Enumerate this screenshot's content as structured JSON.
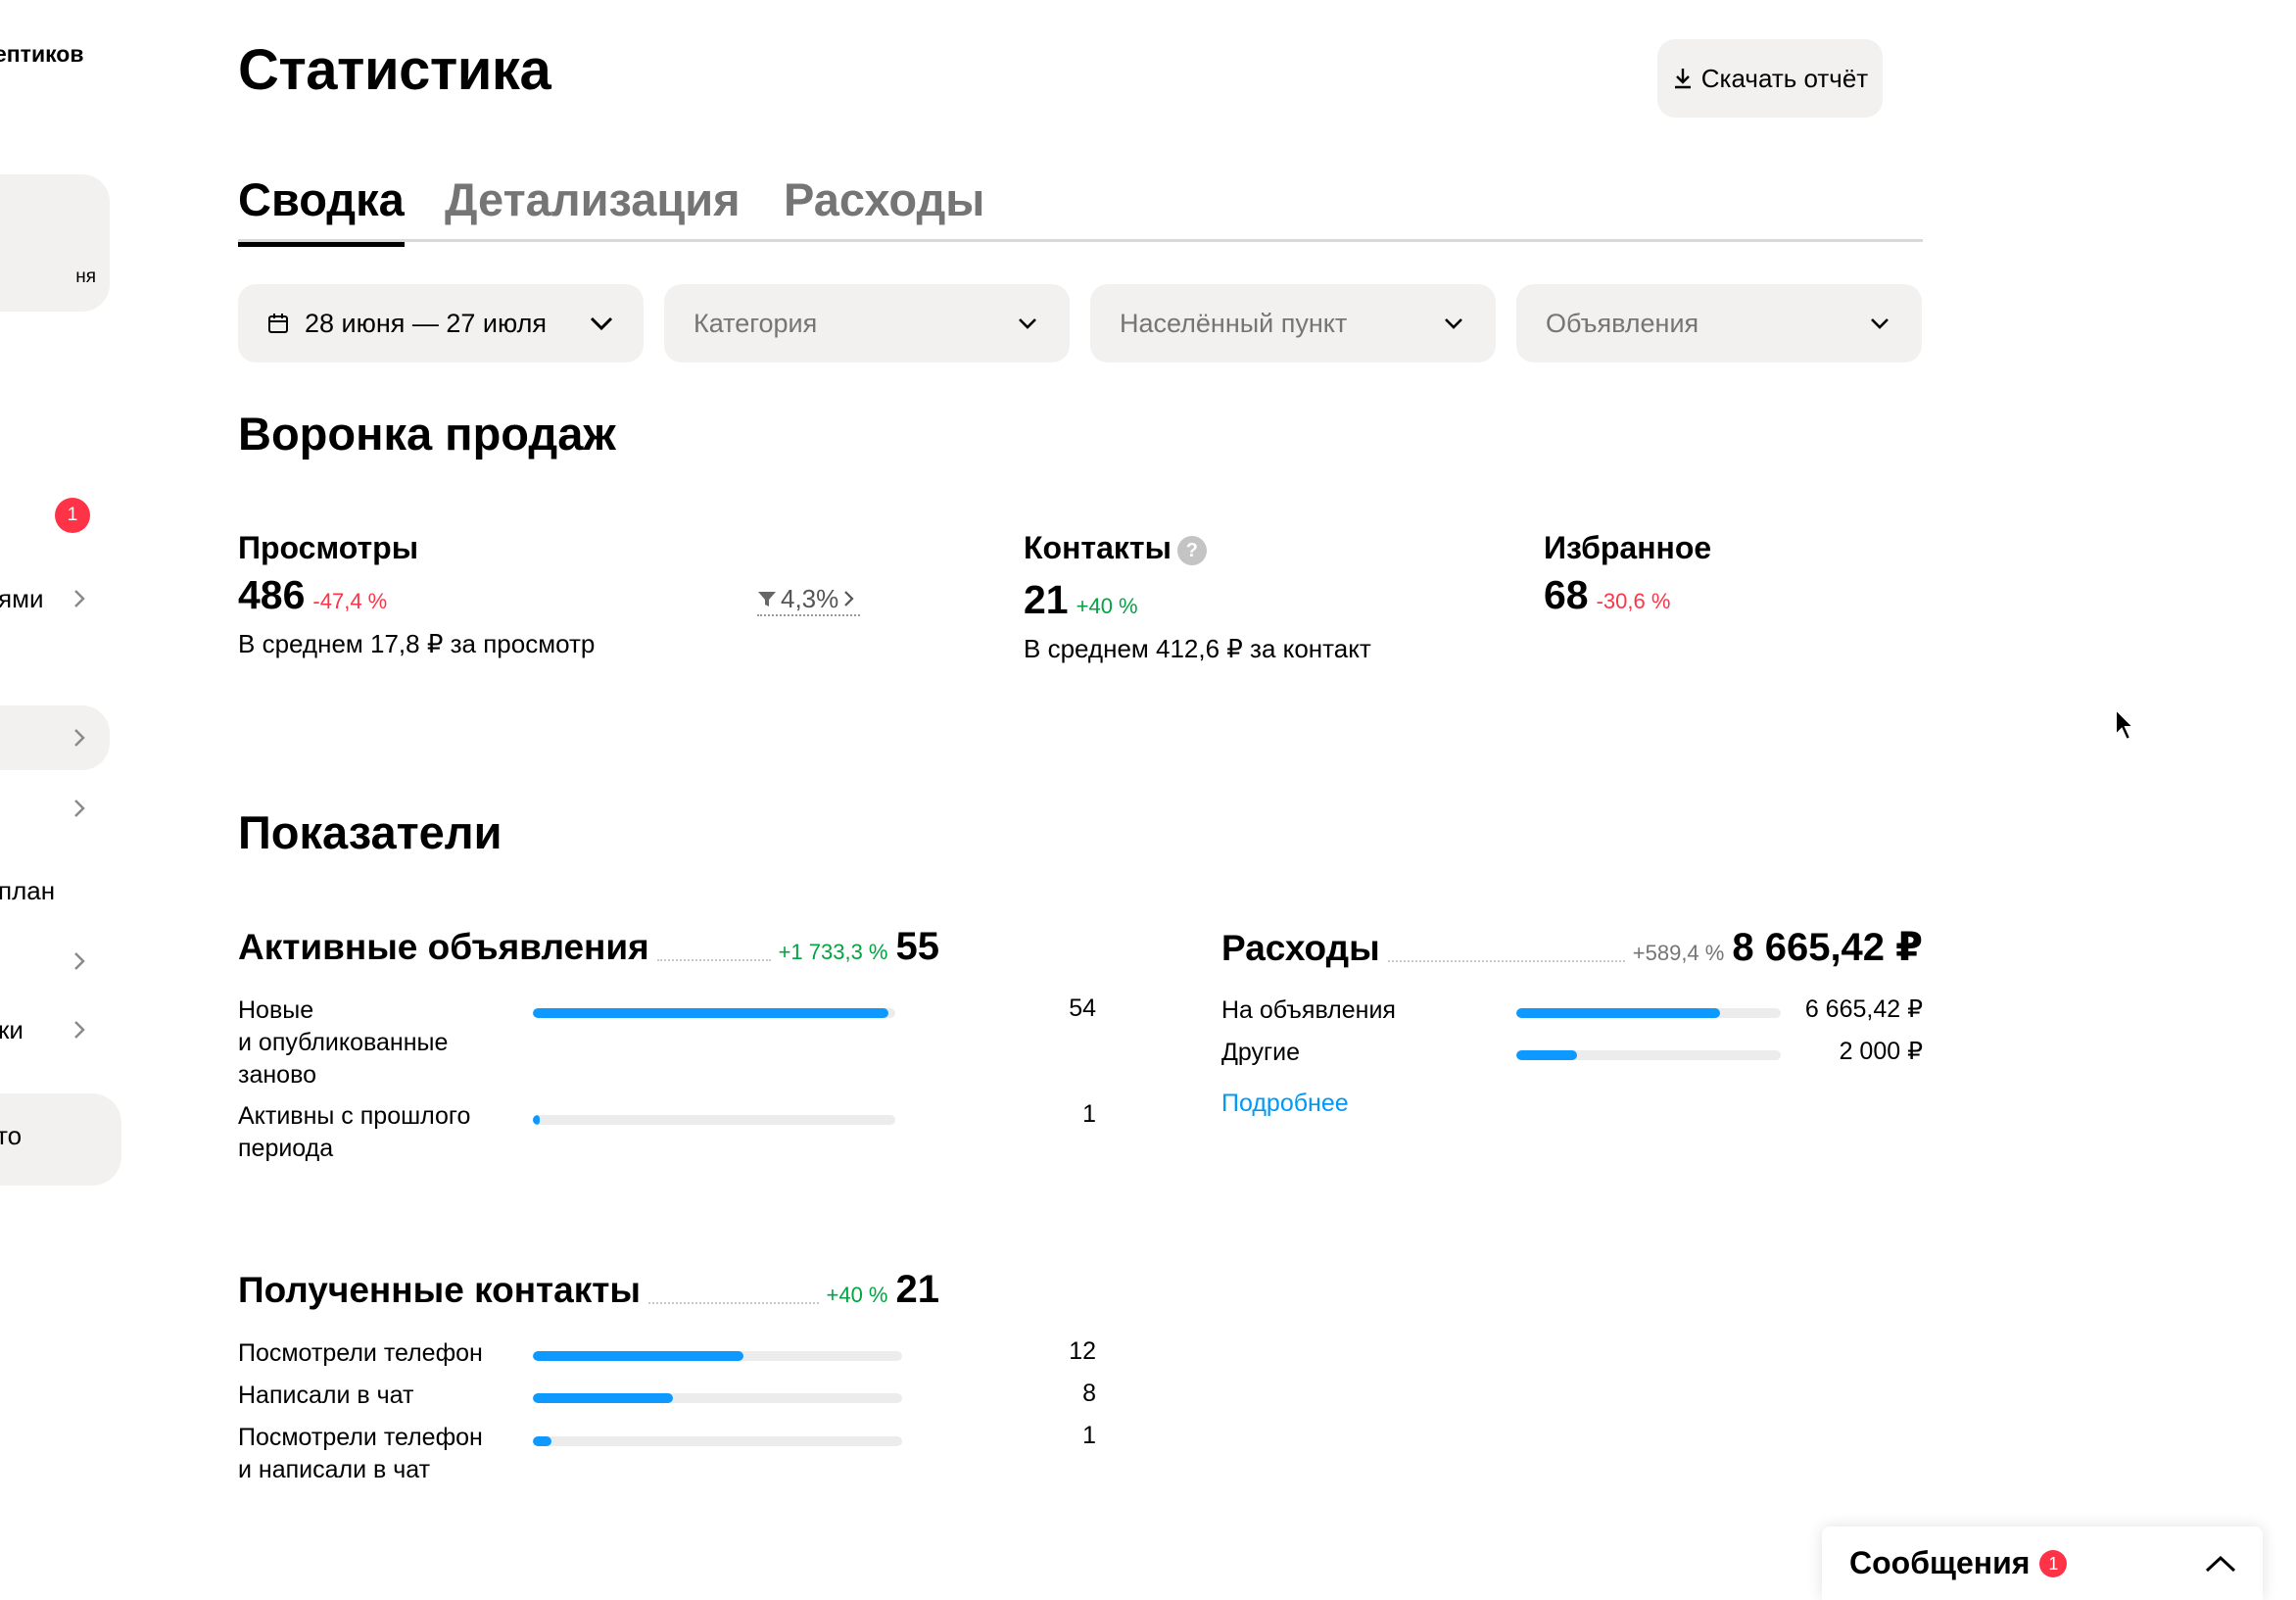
{
  "sidebar": {
    "brand": "ептиков",
    "card_text": "ня",
    "badge": "1",
    "items": [
      {
        "label": "ями"
      },
      {
        "label": ""
      },
      {
        "label": ""
      },
      {
        "label": "план"
      },
      {
        "label": ""
      },
      {
        "label": "ки"
      }
    ],
    "footer": "то"
  },
  "header": {
    "title": "Статистика",
    "download_label": "Скачать отчёт"
  },
  "tabs": [
    {
      "label": "Сводка",
      "active": true
    },
    {
      "label": "Детализация",
      "active": false
    },
    {
      "label": "Расходы",
      "active": false
    }
  ],
  "filters": {
    "date": "28 июня — 27 июля",
    "category": "Категория",
    "city": "Населённый пункт",
    "ads": "Объявления"
  },
  "funnel": {
    "title": "Воронка продаж",
    "views": {
      "label": "Просмотры",
      "value": "486",
      "delta": "-47,4 %",
      "sub": "В среднем 17,8 ₽ за просмотр",
      "conversion": "4,3%"
    },
    "contacts": {
      "label": "Контакты",
      "help": "?",
      "value": "21",
      "delta": "+40 %",
      "sub": "В среднем 412,6 ₽ за контакт"
    },
    "favorites": {
      "label": "Избранное",
      "value": "68",
      "delta": "-30,6 %"
    }
  },
  "indicators": {
    "title": "Показатели",
    "active_ads": {
      "title": "Активные объявления",
      "delta": "+1 733,3 %",
      "value": "55",
      "rows": [
        {
          "label": "Новые и опубликованные заново",
          "label_l1": "Новые",
          "label_l2": "и опубликованные",
          "label_l3": "заново",
          "value": "54",
          "fraction": 0.98
        },
        {
          "label_l1": "Активны с прошлого",
          "label_l2": "периода",
          "value": "1",
          "fraction": 0.02
        }
      ]
    },
    "expenses": {
      "title": "Расходы",
      "delta": "+589,4 %",
      "value": "8 665,42 ₽",
      "rows": [
        {
          "label": "На объявления",
          "value": "6 665,42 ₽",
          "fraction": 0.77
        },
        {
          "label": "Другие",
          "value": "2 000 ₽",
          "fraction": 0.23
        }
      ],
      "more": "Подробнее"
    },
    "contacts": {
      "title": "Полученные контакты",
      "delta": "+40 %",
      "value": "21",
      "rows": [
        {
          "label": "Посмотрели телефон",
          "value": "12",
          "fraction": 0.57
        },
        {
          "label": "Написали в чат",
          "value": "8",
          "fraction": 0.38
        },
        {
          "label_l1": "Посмотрели телефон",
          "label_l2": "и написали в чат",
          "value": "1",
          "fraction": 0.05
        }
      ]
    }
  },
  "messenger": {
    "title": "Сообщения",
    "badge": "1"
  },
  "colors": {
    "accent": "#0d99ff",
    "positive": "#02a442",
    "negative": "#ff3347",
    "surface": "#f2f1f0"
  }
}
